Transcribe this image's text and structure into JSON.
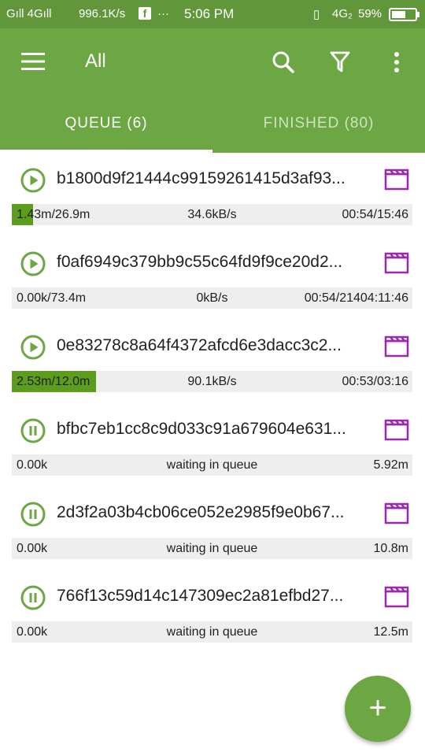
{
  "status_bar": {
    "signal_left": "Gıll 4Gıll",
    "net_speed": "996.1K/s",
    "facebook_glyph": "f",
    "more_dots": "···",
    "time": "5:06 PM",
    "right_indicators": "4G₂",
    "battery": "59%",
    "battery_level": 0.59
  },
  "app_bar": {
    "title": "All",
    "icons": [
      "menu-icon",
      "search-icon",
      "filter-icon",
      "more-vert-icon"
    ]
  },
  "tabs": [
    {
      "label": "QUEUE (6)",
      "active": true
    },
    {
      "label": "FINISHED (80)",
      "active": false
    }
  ],
  "downloads": [
    {
      "name": "b1800d9f21444c99159261415d3af93...",
      "state": "play",
      "left": "1.43m/26.9m",
      "center": "34.6kB/s",
      "right": "00:54/15:46",
      "progress": 0.053
    },
    {
      "name": "f0af6949c379bb9c55c64fd9f9ce20d2...",
      "state": "play",
      "left": "0.00k/73.4m",
      "center": "0kB/s",
      "right": "00:54/21404:11:46",
      "progress": 0
    },
    {
      "name": "0e83278c8a64f4372afcd6e3dacc3c2...",
      "state": "play",
      "left": "2.53m/12.0m",
      "center": "90.1kB/s",
      "right": "00:53/03:16",
      "progress": 0.211
    },
    {
      "name": "bfbc7eb1cc8c9d033c91a679604e631...",
      "state": "pause",
      "left": "0.00k",
      "center": "waiting in queue",
      "right": "5.92m",
      "progress": 0
    },
    {
      "name": "2d3f2a03b4cb06ce052e2985f9e0b67...",
      "state": "pause",
      "left": "0.00k",
      "center": "waiting in queue",
      "right": "10.8m",
      "progress": 0
    },
    {
      "name": "766f13c59d14c147309ec2a81efbd27...",
      "state": "pause",
      "left": "0.00k",
      "center": "waiting in queue",
      "right": "12.5m",
      "progress": 0
    }
  ],
  "fab": {
    "label": "+"
  },
  "colors": {
    "accent": "#6ca744",
    "progress": "#5c9d1d",
    "video_icon": "#9c27b0"
  }
}
